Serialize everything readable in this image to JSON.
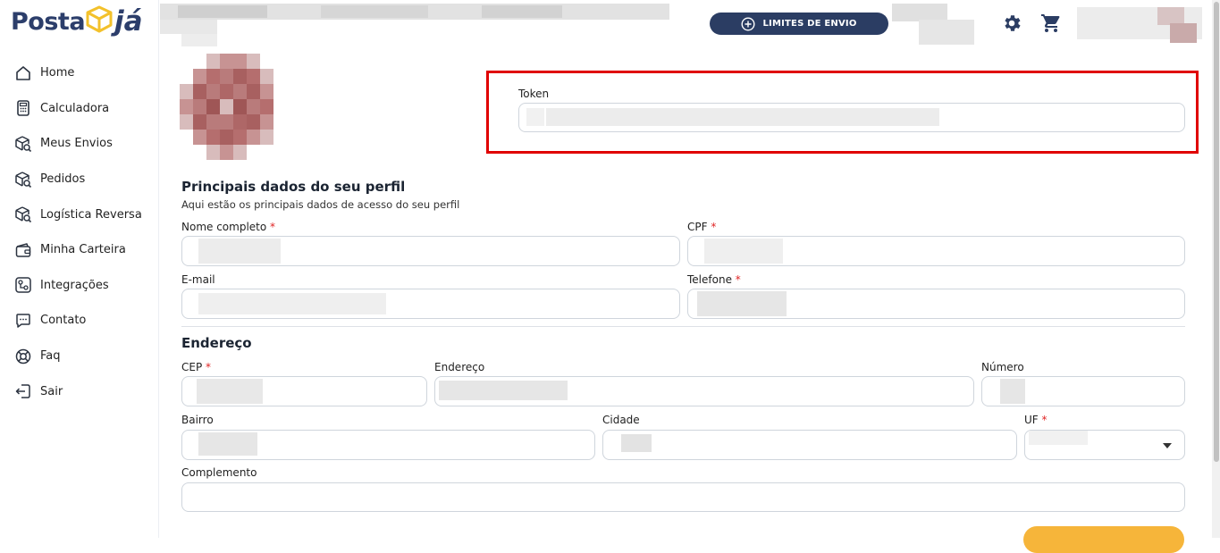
{
  "brand": {
    "name_part1": "Posta",
    "name_part2": "já"
  },
  "sidebar": {
    "items": [
      {
        "label": "Home",
        "icon": "home-icon"
      },
      {
        "label": "Calculadora",
        "icon": "calculator-icon"
      },
      {
        "label": "Meus Envios",
        "icon": "package-search-icon"
      },
      {
        "label": "Pedidos",
        "icon": "package-search-icon"
      },
      {
        "label": "Logística Reversa",
        "icon": "package-search-icon"
      },
      {
        "label": "Minha Carteira",
        "icon": "wallet-icon"
      },
      {
        "label": "Integrações",
        "icon": "integrations-icon"
      },
      {
        "label": "Contato",
        "icon": "chat-icon"
      },
      {
        "label": "Faq",
        "icon": "lifebuoy-icon"
      },
      {
        "label": "Sair",
        "icon": "logout-icon"
      }
    ]
  },
  "header": {
    "limits_button": "LIMITES DE ENVIO",
    "settings_icon": "gear-icon",
    "cart_icon": "cart-icon"
  },
  "token": {
    "label": "Token",
    "value": ""
  },
  "profile": {
    "title": "Principais dados do seu perfil",
    "subtitle": "Aqui estão os principais dados de acesso do seu perfil",
    "fields": {
      "nome": {
        "label": "Nome completo",
        "required": "*",
        "value": ""
      },
      "cpf": {
        "label": "CPF",
        "required": "*",
        "value": ""
      },
      "email": {
        "label": "E-mail",
        "value": ""
      },
      "telefone": {
        "label": "Telefone",
        "required": "*",
        "value": ""
      }
    }
  },
  "address": {
    "title": "Endereço",
    "fields": {
      "cep": {
        "label": "CEP",
        "required": "*",
        "value": ""
      },
      "endereco": {
        "label": "Endereço",
        "value": ""
      },
      "numero": {
        "label": "Número",
        "value": ""
      },
      "bairro": {
        "label": "Bairro",
        "value": ""
      },
      "cidade": {
        "label": "Cidade",
        "value": ""
      },
      "uf": {
        "label": "UF",
        "required": "*",
        "value": ""
      },
      "complemento": {
        "label": "Complemento",
        "value": ""
      }
    }
  },
  "colors": {
    "brand_navy": "#2b3d63",
    "highlight_red": "#e00000",
    "save_orange": "#f6b53a",
    "logo_yellow": "#f3c12b"
  }
}
